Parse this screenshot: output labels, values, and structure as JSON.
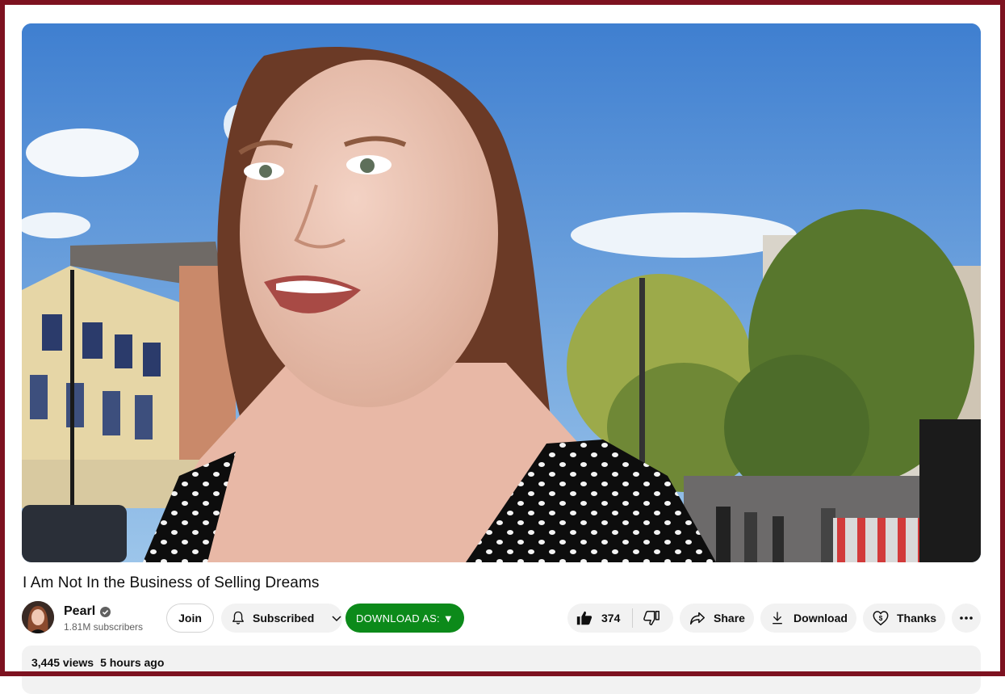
{
  "video": {
    "title": "I Am Not In the Business of Selling Dreams"
  },
  "channel": {
    "name": "Pearl",
    "subscribers": "1.81M subscribers",
    "verified": true
  },
  "actions": {
    "join_label": "Join",
    "subscribed_label": "Subscribed",
    "download_as_label": "DOWNLOAD AS: ▼",
    "like_count": "374",
    "share_label": "Share",
    "download_label": "Download",
    "thanks_label": "Thanks"
  },
  "description": {
    "views": "3,445 views",
    "time_ago": "5 hours ago"
  },
  "icons": [
    "bell-icon",
    "chevron-down-icon",
    "thumbs-up-icon",
    "thumbs-down-icon",
    "share-icon",
    "download-icon",
    "thanks-icon",
    "more-icon",
    "verified-icon"
  ],
  "colors": {
    "frame": "#7d1220",
    "download_as_button": "#0c8a1a",
    "pill_background": "#f2f2f2"
  }
}
